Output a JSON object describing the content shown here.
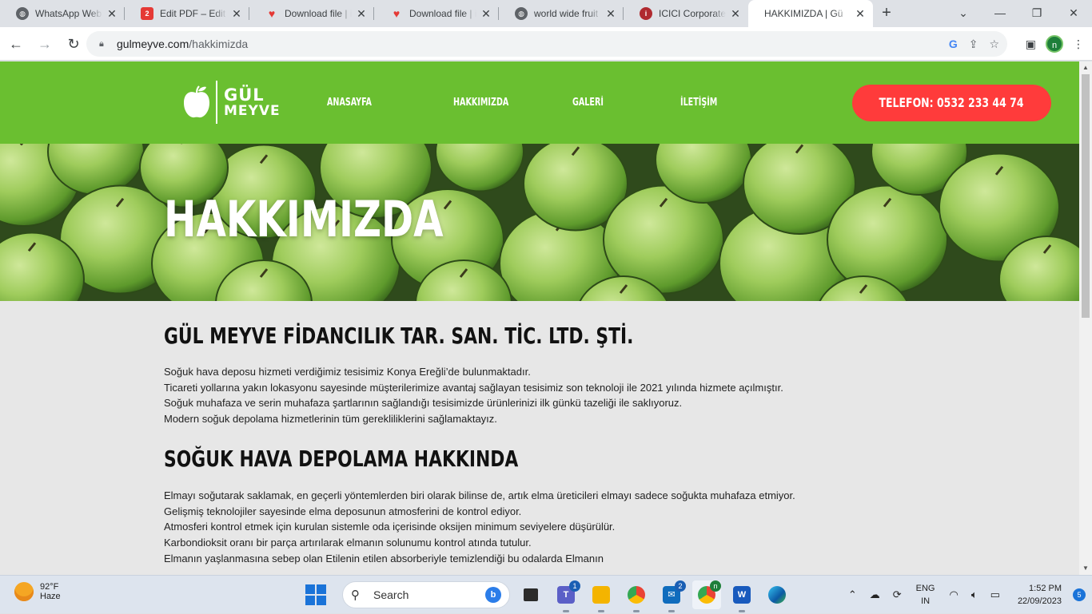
{
  "browser": {
    "tabs": [
      {
        "label": "WhatsApp Web",
        "icon": "globe-icon",
        "color": "#5f6368"
      },
      {
        "label": "Edit PDF – Edit PDF",
        "icon": "pdf-edit-icon",
        "color": "#e53935"
      },
      {
        "label": "Download file | iL",
        "icon": "heart-icon",
        "color": "#e53935"
      },
      {
        "label": "Download file | iL",
        "icon": "heart-icon",
        "color": "#e53935"
      },
      {
        "label": "world wide fruit (",
        "icon": "globe-icon",
        "color": "#5f6368"
      },
      {
        "label": "ICICI Corporate e",
        "icon": "icici-icon",
        "color": "#b02a30"
      },
      {
        "label": "HAKKIMIZDA | Gü",
        "icon": "page-icon",
        "color": "#5f6368"
      }
    ],
    "active_tab": 6,
    "url_host": "gulmeyve.com",
    "url_path": "/hakkimizda",
    "profile_initial": "n"
  },
  "site": {
    "logo_line1": "GÜL",
    "logo_line2": "MEYVE",
    "menu": [
      "ANASAYFA",
      "HAKKIMIZDA",
      "GALERİ",
      "İLETİŞİM"
    ],
    "phone_button": "TELEFON: 0532 233 44 74",
    "hero_title": "HAKKIMIZDA",
    "section1_title": "GÜL MEYVE FİDANCILIK TAR. SAN. TİC. LTD. ŞTİ.",
    "section1_lines": [
      "Soğuk hava deposu hizmeti verdiğimiz tesisimiz Konya Ereğli’de bulunmaktadır.",
      "Ticareti yollarına yakın lokasyonu sayesinde müşterilerimize avantaj sağlayan tesisimiz son teknoloji ile 2021 yılında hizmete açılmıştır.",
      "Soğuk muhafaza ve serin muhafaza şartlarının sağlandığı tesisimizde ürünlerinizi ilk günkü tazeliği ile saklıyoruz.",
      "Modern soğuk depolama hizmetlerinin tüm gerekliliklerini sağlamaktayız."
    ],
    "section2_title": "SOĞUK HAVA DEPOLAMA HAKKINDA",
    "section2_lines": [
      "Elmayı soğutarak saklamak, en geçerli yöntemlerden biri olarak bilinse de, artık elma üreticileri elmayı sadece soğukta muhafaza etmiyor.",
      "Gelişmiş teknolojiler sayesinde elma deposunun atmosferini de kontrol ediyor.",
      "Atmosferi kontrol etmek için kurulan sistemle oda içerisinde oksijen minimum seviyelere düşürülür.",
      "Karbondioksit oranı bir parça artırılarak elmanın solunumu kontrol atında tutulur.",
      "Elmanın yaşlanmasına sebep olan Etilenin  etilen absorberiyle  temizlendiği bu odalarda Elmanın"
    ],
    "colors": {
      "header": "#6abf30",
      "phone_button": "#ff3b3b"
    }
  },
  "taskbar": {
    "weather_temp": "92°F",
    "weather_text": "Haze",
    "search_placeholder": "Search",
    "apps": [
      {
        "name": "task-view",
        "badge": ""
      },
      {
        "name": "teams",
        "badge": "1"
      },
      {
        "name": "file-explorer",
        "badge": ""
      },
      {
        "name": "chrome",
        "badge": ""
      },
      {
        "name": "mail",
        "badge": "2"
      },
      {
        "name": "chrome-profile",
        "badge": "n"
      },
      {
        "name": "word",
        "badge": ""
      },
      {
        "name": "edge",
        "badge": ""
      }
    ],
    "lang_line1": "ENG",
    "lang_line2": "IN",
    "time": "1:52 PM",
    "date": "22/09/2023",
    "notification_count": "5"
  }
}
